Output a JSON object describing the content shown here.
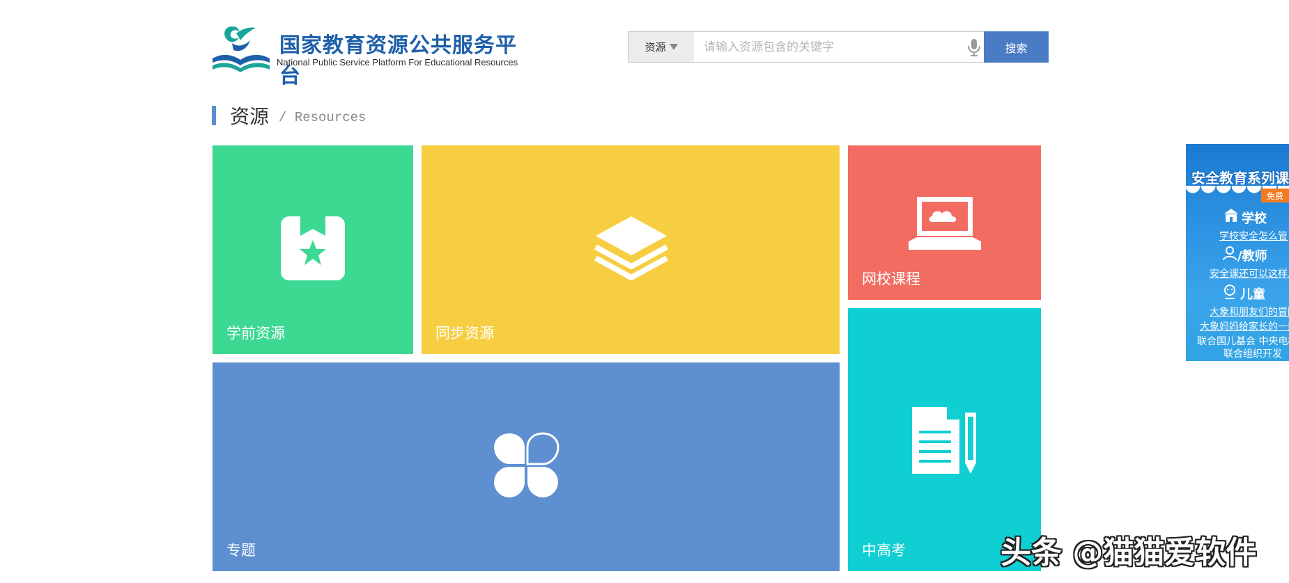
{
  "logo": {
    "title_cn": "国家教育资源公共服务平台",
    "title_en": "National Public Service Platform For Educational Resources",
    "icon": "logo-book-icon",
    "colors": {
      "teal": "#1aa59a",
      "blue": "#1d5fa8"
    }
  },
  "search": {
    "type_label": "资源",
    "placeholder": "请输入资源包含的关键字",
    "value": "",
    "button_label": "搜索",
    "mic_icon": "microphone-icon",
    "accent": "#4a7cc5"
  },
  "section": {
    "title_cn": "资源",
    "title_en": "/ Resources",
    "bar_color": "#5b8fd0"
  },
  "tiles": {
    "preschool": {
      "label": "学前资源",
      "icon": "bookmark-star-icon",
      "color": "#3dd892"
    },
    "sync": {
      "label": "同步资源",
      "icon": "layers-icon",
      "color": "#f7ce42"
    },
    "online": {
      "label": "网校课程",
      "icon": "laptop-cloud-icon",
      "color": "#f26c62"
    },
    "topic": {
      "label": "专题",
      "icon": "clover-icon",
      "color": "#5d8fd1"
    },
    "exam": {
      "label": "中高考",
      "icon": "document-pencil-icon",
      "color": "#10cfd2"
    }
  },
  "side_ad": {
    "title": "安全教育系列课",
    "free_badge": "免费",
    "school_label": "学校",
    "school_link": "学校安全怎么管",
    "teacher_label": "/教师",
    "teacher_link": "安全课还可以这样上",
    "child_label": "儿童",
    "child_link_1": "大象和朋友们的冒险",
    "child_link_2": "大象妈妈给家长的一封信",
    "footer_1": "联合国儿基会  中央电教馆",
    "footer_2": "联合组织开发"
  },
  "watermark": "头条 @猫猫爱软件"
}
